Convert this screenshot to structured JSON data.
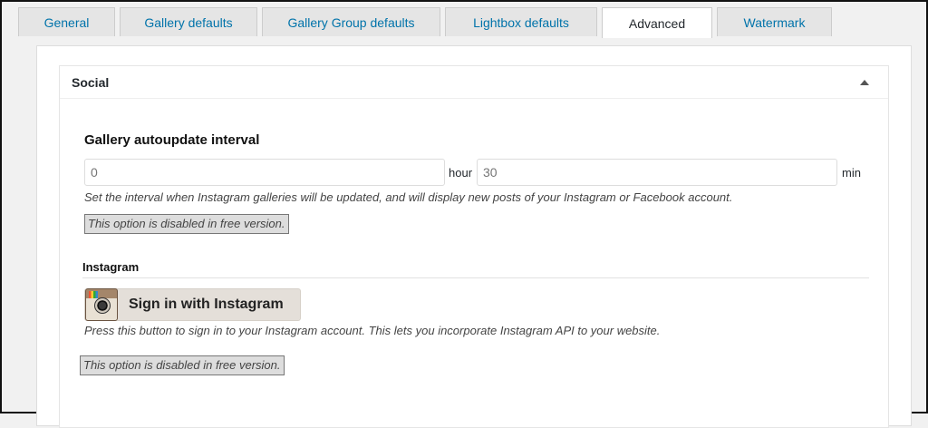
{
  "tabs": [
    {
      "label": "General"
    },
    {
      "label": "Gallery defaults"
    },
    {
      "label": "Gallery Group defaults"
    },
    {
      "label": "Lightbox defaults"
    },
    {
      "label": "Advanced",
      "active": true
    },
    {
      "label": "Watermark"
    }
  ],
  "postbox": {
    "title": "Social"
  },
  "autoupdate": {
    "label": "Gallery autoupdate interval",
    "hours_placeholder": "0",
    "hours_unit": "hour",
    "minutes_placeholder": "30",
    "minutes_unit": "min",
    "description": "Set the interval when Instagram galleries will be updated, and will display new posts of your Instagram or Facebook account.",
    "disabled_note": "This option is disabled in free version."
  },
  "instagram": {
    "section_title": "Instagram",
    "button_label": "Sign in with Instagram",
    "description": "Press this button to sign in to your Instagram account. This lets you incorporate Instagram API to your website.",
    "disabled_note": "This option is disabled in free version."
  }
}
